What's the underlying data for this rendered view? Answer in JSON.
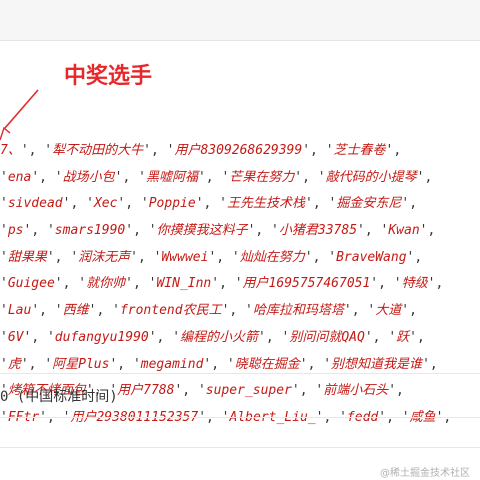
{
  "annotation": {
    "label": "中奖选手"
  },
  "winners_output": {
    "lines": [
      [
        "7、",
        "犁不动田的大牛",
        "用户8309268629399",
        "芝士春卷"
      ],
      [
        "ena",
        "战场小包",
        "黑嘘阿福",
        "芒果在努力",
        "敲代码的小提琴"
      ],
      [
        "sivdead",
        "Xec",
        "Poppie",
        "王先生技术栈",
        "掘金安东尼"
      ],
      [
        "ps",
        "smars1990",
        "你摸摸我这料子",
        "小猪君33785",
        "Kwan"
      ],
      [
        "甜果果",
        "润沫无声",
        "Wwwwei",
        "灿灿在努力",
        "BraveWang"
      ],
      [
        "Guigee",
        "就你帅",
        "WIN_Inn",
        "用户1695757467051",
        "特级"
      ],
      [
        "Lau",
        "西维",
        "frontend农民工",
        "哈库拉和玛塔塔",
        "大道"
      ],
      [
        "6V",
        "dufangyu1990",
        "编程的小火箭",
        "别问问就QAQ",
        "跃"
      ],
      [
        "虎",
        "阿星Plus",
        "megamind",
        "晓聪在掘金",
        "别想知道我是谁"
      ],
      [
        "烤箱不烤面包",
        "用户7788",
        "super_super",
        "前端小石头"
      ],
      [
        "FFtr",
        "用户2938011152357",
        "Albert_Liu_",
        "fedd",
        "咸鱼"
      ]
    ]
  },
  "date_output": {
    "text": "0 (中国标准时间)"
  },
  "watermark": {
    "text": "@稀土掘金技术社区"
  }
}
